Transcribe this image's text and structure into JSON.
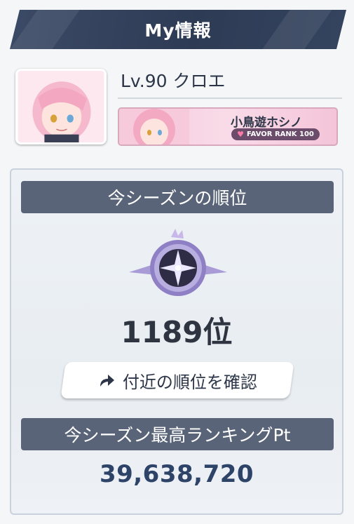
{
  "header": {
    "title": "My情報"
  },
  "player": {
    "level_name": "Lv.90 クロエ"
  },
  "favor": {
    "student_name": "小鳥遊ホシノ",
    "rank_label": "FAVOR RANK 100"
  },
  "season": {
    "rank_heading": "今シーズンの順位",
    "rank_value": "1189位",
    "nearby_button_label": "付近の順位を確認",
    "best_heading": "今シーズン最高ランキングPt",
    "best_points": "39,638,720"
  }
}
